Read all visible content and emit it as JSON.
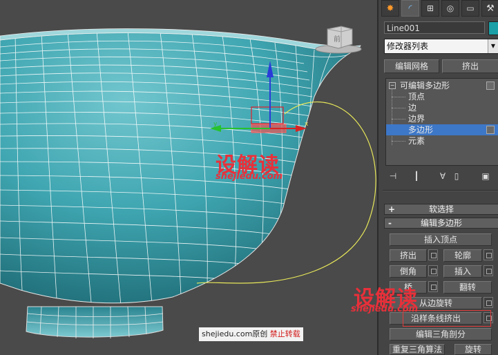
{
  "panel": {
    "object_name": "Line001",
    "object_color": "#1aa0a6",
    "modifier_list": "修改器列表",
    "quick_buttons": {
      "edit_mesh": "编辑网格",
      "extrude": "挤出"
    },
    "stack": {
      "root": "可编辑多边形",
      "items": [
        "顶点",
        "边",
        "边界",
        "多边形",
        "元素"
      ],
      "selected": "多边形"
    },
    "rollouts": {
      "soft_selection": {
        "sign": "+",
        "label": "软选择"
      },
      "edit_polygons": {
        "sign": "-",
        "label": "编辑多边形"
      }
    },
    "buttons": {
      "insert_vertex": "插入顶点",
      "extrude": "挤出",
      "outline": "轮廓",
      "bevel": "倒角",
      "inset": "插入",
      "bridge": "桥",
      "flip": "翻转",
      "hinge_from_edge": "从边旋转",
      "extrude_along_spline": "沿样条线挤出",
      "edit_triangulation": "编辑三角剖分",
      "retriangulate": "重复三角算法",
      "turn": "旋转"
    }
  },
  "viewport": {
    "viewcube_label": "前",
    "gizmo_axes": {
      "x": "x",
      "y": "y"
    }
  },
  "watermarks": {
    "brand": "设解读",
    "site": "shejiedu.com",
    "credit_main": "shejiedu.com原创",
    "credit_red": "禁止转载"
  },
  "colors": {
    "mesh": "#1f8e98",
    "wire": "#ffffff",
    "spline": "#e8e85a",
    "selection": "#3d77c7",
    "watermark": "#e8303a",
    "highlight_box": "#e23b3b"
  }
}
